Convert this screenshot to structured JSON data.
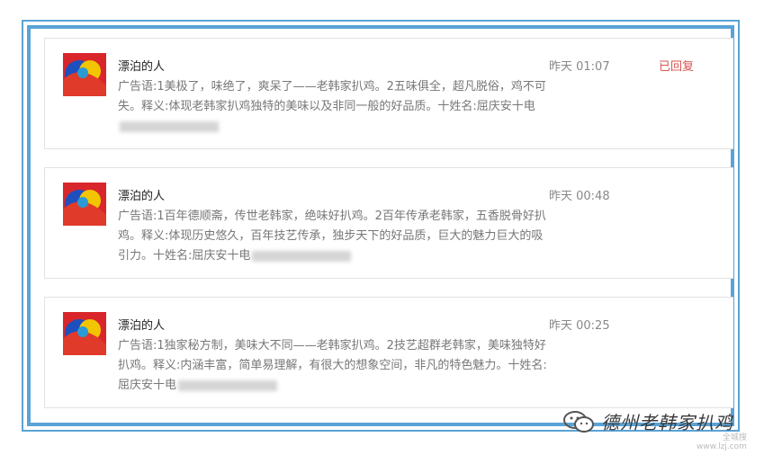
{
  "messages": [
    {
      "author": "漂泊的人",
      "time": "昨天 01:07",
      "status": "已回复",
      "content": "广告语:1美极了，味绝了，爽呆了——老韩家扒鸡。2五味俱全，超凡脱俗，鸡不可失。释义:体现老韩家扒鸡独特的美味以及非同一般的好品质。十姓名:屈庆安十电"
    },
    {
      "author": "漂泊的人",
      "time": "昨天 00:48",
      "status": "",
      "content": "广告语:1百年德顺斋，传世老韩家，绝味好扒鸡。2百年传承老韩家，五香脱骨好扒鸡。释义:体现历史悠久，百年技艺传承，独步天下的好品质，巨大的魅力巨大的吸引力。十姓名:屈庆安十电"
    },
    {
      "author": "漂泊的人",
      "time": "昨天 00:25",
      "status": "",
      "content": "广告语:1独家秘方制，美味大不同——老韩家扒鸡。2技艺超群老韩家，美味独特好扒鸡。释义:内涵丰富，简单易理解，有很大的想象空间，非凡的特色魅力。十姓名:屈庆安十电"
    }
  ],
  "watermark": {
    "text": "德州老韩家扒鸡",
    "icon": "wechat-icon",
    "site_line1": "全城搜",
    "site_line2": "www.lzj.com"
  },
  "colors": {
    "frame": "#5aa3d6",
    "replied": "#d9534f"
  }
}
